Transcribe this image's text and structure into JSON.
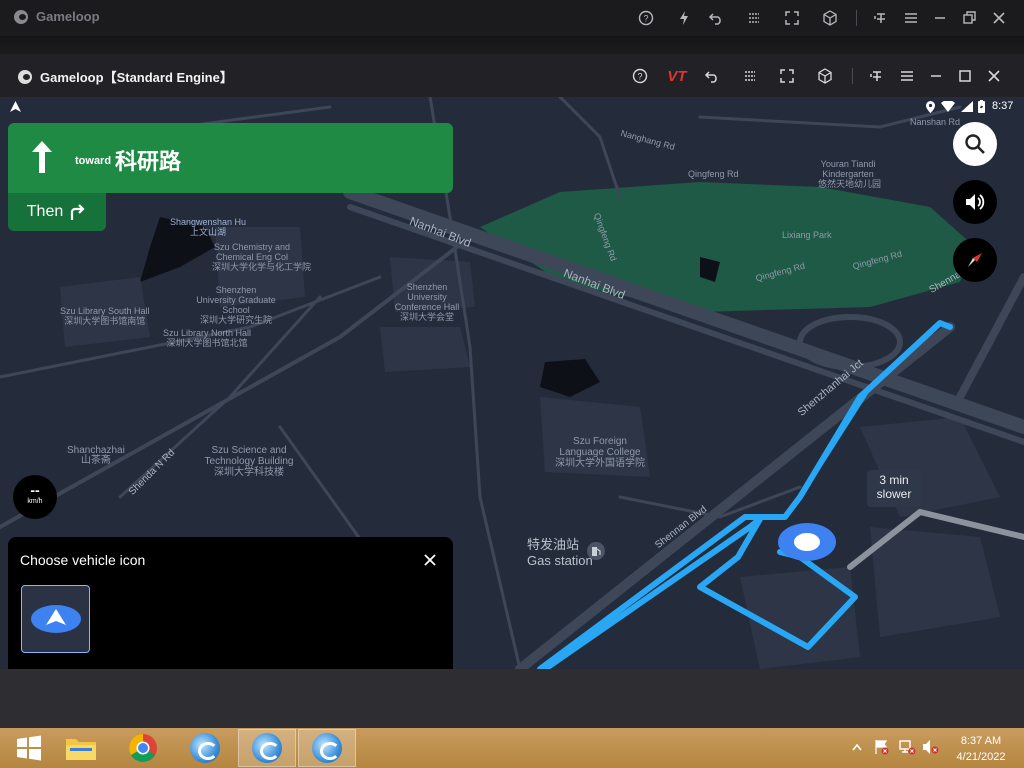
{
  "outer_window": {
    "title": "Gameloop"
  },
  "inner_window": {
    "title": "Gameloop【Standard Engine】",
    "vt_label": "VT"
  },
  "status_bar": {
    "time": "8:37"
  },
  "navigation": {
    "toward_label": "toward",
    "street": "科研路",
    "then_label": "Then"
  },
  "map": {
    "road_labels": [
      "Nanhai Blvd",
      "Nanhai Blvd",
      "Shennan Blvd",
      "Shenzhanhai Jct",
      "Shenda N Rd",
      "Nanshan Rd",
      "Shenna"
    ],
    "place_labels": {
      "shangwenshan_en": "Shangwenshan Hu",
      "shangwenshan_cn": "上文山湖",
      "szu_chem_en": "Szu Chemistry and Chemical Eng Col",
      "szu_chem_cn": "深圳大学化学与化工学院",
      "szu_grad_en": "Shenzhen University Graduate School",
      "szu_grad_cn": "深圳大学研究生院",
      "szu_lib_south_en": "Szu Library South Hall",
      "szu_lib_south_cn": "深圳大学图书馆南馆",
      "szu_lib_north_en": "Szu Library North Hall",
      "szu_lib_north_cn": "深圳大学图书馆北馆",
      "szu_conf_en": "Shenzhen University Conference Hall",
      "szu_conf_cn": "深圳大学会堂",
      "shanchazhai_en": "Shanchazhai",
      "shanchazhai_cn": "山茶斋",
      "szu_sci_en": "Szu Science and Technology Building",
      "szu_sci_cn": "深圳大学科技楼",
      "szu_lang_en": "Szu Foreign Language College",
      "szu_lang_cn": "深圳大学外国语学院",
      "lixiang_park": "Lixiang Park",
      "qingfeng_rd_1": "Qingfeng Rd",
      "qingfeng_rd_2": "Qingfeng Rd",
      "qingfeng_rd_3": "Qingfeng Rd",
      "qingfeng_rd_4": "Qingfeng Rd",
      "nanghang_rd": "Nanghang Rd",
      "youran_en": "Youran Tiandi Kindergarten",
      "youran_cn": "悠然天地幼儿园",
      "gas_cn": "特发油站",
      "gas_en": "Gas station"
    },
    "traffic_tip": "3 min slower",
    "speed_value": "--",
    "speed_unit": "km/h"
  },
  "vehicle_sheet": {
    "title": "Choose vehicle icon"
  },
  "taskbar": {
    "clock_time": "8:37 AM",
    "clock_date": "4/21/2022"
  },
  "colors": {
    "map_bg": "#242c3c",
    "park": "#1e5a45",
    "route": "#29a7f5",
    "nav_green": "#1f8a43"
  }
}
